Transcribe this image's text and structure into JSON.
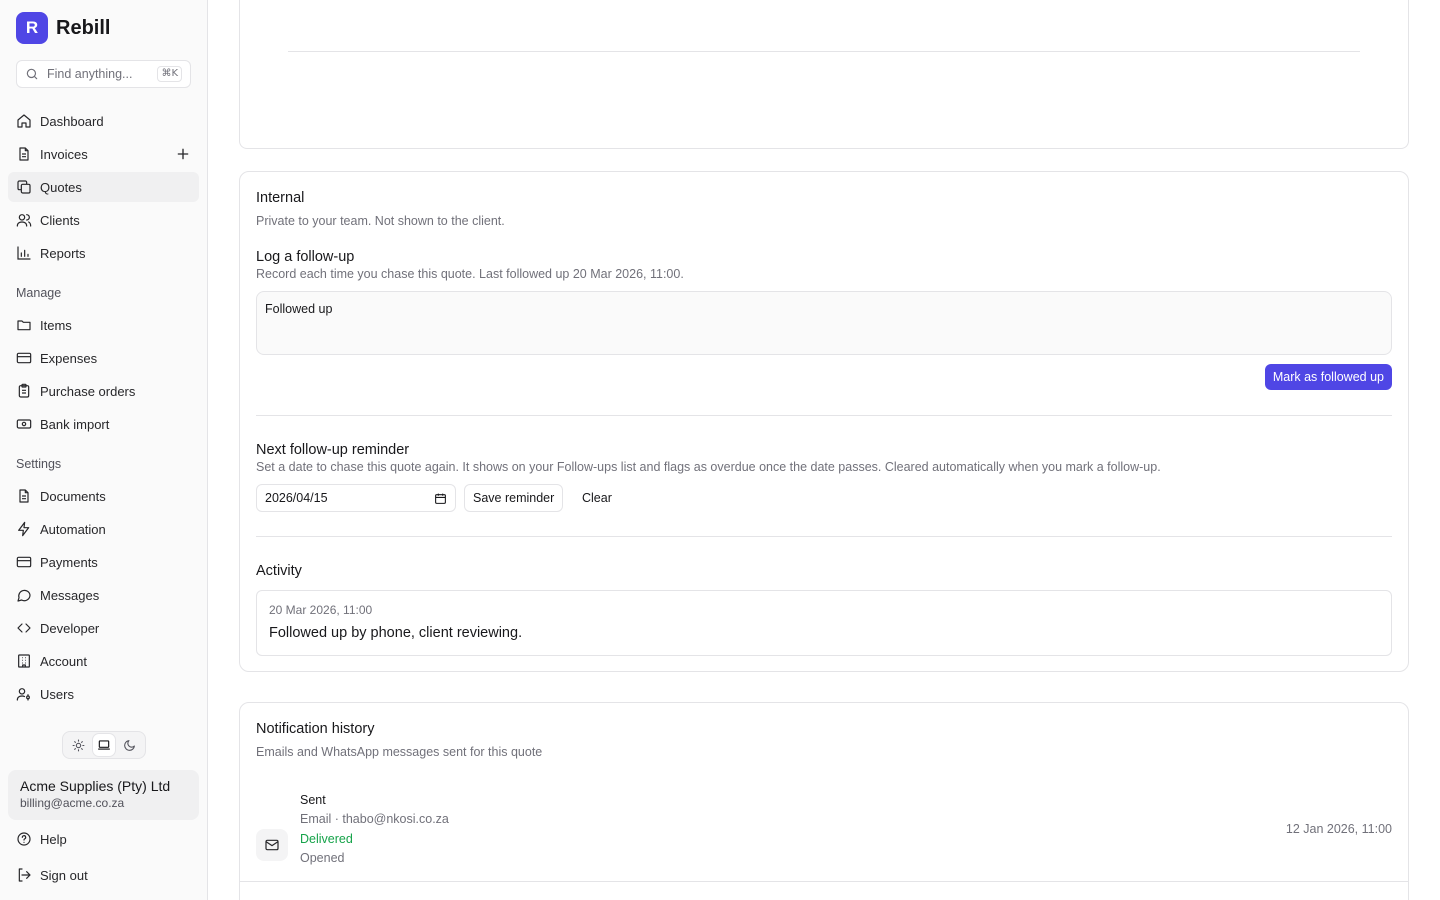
{
  "brand": {
    "logo_letter": "R",
    "name": "Rebill"
  },
  "search": {
    "placeholder": "Find anything...",
    "shortcut": "⌘K"
  },
  "nav": {
    "main": [
      {
        "label": "Dashboard",
        "icon": "home-icon"
      },
      {
        "label": "Invoices",
        "icon": "file-text-icon"
      },
      {
        "label": "Quotes",
        "icon": "copy-icon"
      },
      {
        "label": "Clients",
        "icon": "users-icon"
      },
      {
        "label": "Reports",
        "icon": "bar-chart-icon"
      }
    ],
    "manage_label": "Manage",
    "manage": [
      {
        "label": "Items",
        "icon": "folder-icon"
      },
      {
        "label": "Expenses",
        "icon": "credit-card-icon"
      },
      {
        "label": "Purchase orders",
        "icon": "clipboard-icon"
      },
      {
        "label": "Bank import",
        "icon": "banknote-icon"
      }
    ],
    "settings_label": "Settings",
    "settings": [
      {
        "label": "Documents",
        "icon": "file-text-icon"
      },
      {
        "label": "Automation",
        "icon": "zap-icon"
      },
      {
        "label": "Payments",
        "icon": "credit-card-icon"
      },
      {
        "label": "Messages",
        "icon": "message-circle-icon"
      },
      {
        "label": "Developer",
        "icon": "code-icon"
      },
      {
        "label": "Account",
        "icon": "building-icon"
      },
      {
        "label": "Users",
        "icon": "user-key-icon"
      }
    ],
    "active": "Quotes"
  },
  "theme": {
    "options": [
      "light",
      "system",
      "dark"
    ],
    "selected": "system"
  },
  "account": {
    "name": "Acme Supplies (Pty) Ltd",
    "email": "billing@acme.co.za"
  },
  "footer": {
    "help": "Help",
    "sign_out": "Sign out"
  },
  "internal": {
    "title": "Internal",
    "subtitle": "Private to your team. Not shown to the client.",
    "followup_title": "Log a follow-up",
    "followup_sub": "Record each time you chase this quote. Last followed up 20 Mar 2026, 11:00.",
    "followup_value": "Followed up",
    "mark_button": "Mark as followed up",
    "reminder_title": "Next follow-up reminder",
    "reminder_sub": "Set a date to chase this quote again. It shows on your Follow-ups list and flags as overdue once the date passes. Cleared automatically when you mark a follow-up.",
    "reminder_date": "2026/04/15",
    "save_button": "Save reminder",
    "clear_button": "Clear",
    "activity_title": "Activity",
    "activity": [
      {
        "time": "20 Mar 2026, 11:00",
        "text": "Followed up by phone, client reviewing."
      }
    ]
  },
  "notifications": {
    "title": "Notification history",
    "subtitle": "Emails and WhatsApp messages sent for this quote",
    "items": [
      {
        "status": "Sent",
        "channel": "Email · thabo@nkosi.co.za",
        "delivery": "Delivered",
        "opened": "Opened",
        "date": "12 Jan 2026, 11:00"
      }
    ]
  },
  "colors": {
    "accent": "#4f46e5",
    "success": "#16a34a",
    "muted": "#71717a",
    "border": "#e4e4e7"
  }
}
